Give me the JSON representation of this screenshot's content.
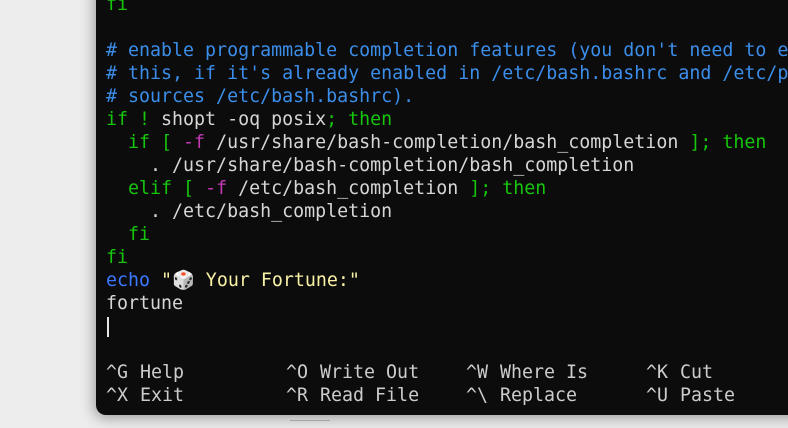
{
  "editor": {
    "lines": [
      [
        {
          "t": "fi",
          "c": "kw"
        }
      ],
      [],
      [
        {
          "t": "# enable programmable completion features (you don't need to enable",
          "c": "comment"
        }
      ],
      [
        {
          "t": "# this, if it's already enabled in /etc/bash.bashrc and /etc/profile",
          "c": "comment"
        }
      ],
      [
        {
          "t": "# sources /etc/bash.bashrc).",
          "c": "comment"
        }
      ],
      [
        {
          "t": "if ! ",
          "c": "kw"
        },
        {
          "t": "shopt -oq posix",
          "c": "cmd"
        },
        {
          "t": "; then",
          "c": "kw"
        }
      ],
      [
        {
          "t": "  if [ ",
          "c": "kw"
        },
        {
          "t": "-f",
          "c": "flag"
        },
        {
          "t": " /usr/share/bash-completion/bash_completion ",
          "c": "cmd"
        },
        {
          "t": "]; then",
          "c": "kw"
        }
      ],
      [
        {
          "t": "    . /usr/share/bash-completion/bash_completion",
          "c": "cmd"
        }
      ],
      [
        {
          "t": "  elif [ ",
          "c": "kw"
        },
        {
          "t": "-f",
          "c": "flag"
        },
        {
          "t": " /etc/bash_completion ",
          "c": "cmd"
        },
        {
          "t": "]; then",
          "c": "kw"
        }
      ],
      [
        {
          "t": "    . /etc/bash_completion",
          "c": "cmd"
        }
      ],
      [
        {
          "t": "  fi",
          "c": "kw"
        }
      ],
      [
        {
          "t": "fi",
          "c": "kw"
        }
      ],
      [
        {
          "t": "echo",
          "c": "echo-kw"
        },
        {
          "t": " \"🎲 Your Fortune:\"",
          "c": "str"
        }
      ],
      [
        {
          "t": "fortune",
          "c": "cmd"
        }
      ]
    ]
  },
  "help": {
    "rows": [
      [
        {
          "key": "^G",
          "label": "Help"
        },
        {
          "key": "^O",
          "label": "Write Out"
        },
        {
          "key": "^W",
          "label": "Where Is"
        },
        {
          "key": "^K",
          "label": "Cut"
        }
      ],
      [
        {
          "key": "^X",
          "label": "Exit"
        },
        {
          "key": "^R",
          "label": "Read File"
        },
        {
          "key": "^\\",
          "label": "Replace"
        },
        {
          "key": "^U",
          "label": "Paste"
        }
      ]
    ]
  }
}
